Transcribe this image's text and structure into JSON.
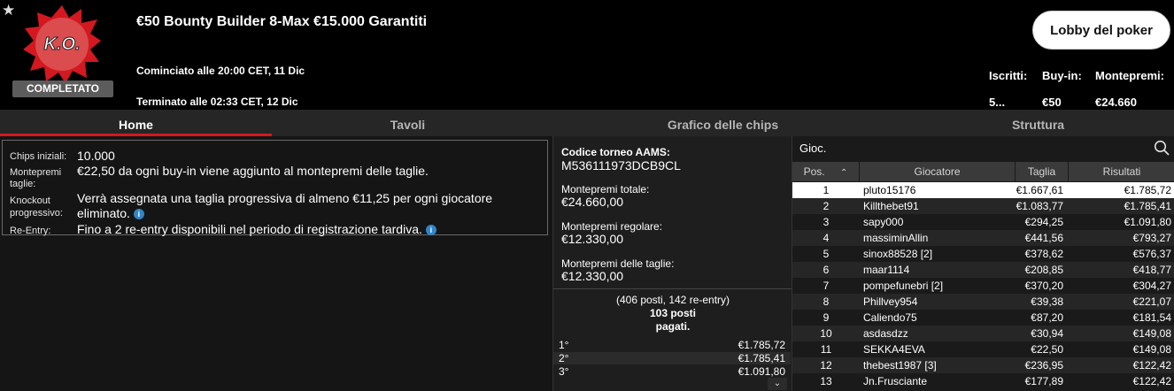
{
  "header": {
    "star_icon": "star-icon",
    "badge_text": "K.O.",
    "status": "COMPLETATO",
    "title": "€50 Bounty Builder 8-Max €15.000 Garantiti",
    "started": "Cominciato alle 20:00 CET, 11 Dic",
    "ended": "Terminato alle 02:33 CET, 12 Dic",
    "lobby_button": "Lobby del poker",
    "stats": {
      "entrants_label": "Iscritti:",
      "entrants_value": "5...",
      "buyin_label": "Buy-in:",
      "buyin_value": "€50",
      "prize_label": "Montepremi:",
      "prize_value": "€24.660"
    }
  },
  "tabs": [
    "Home",
    "Tavoli",
    "Grafico delle chips",
    "Struttura"
  ],
  "info": {
    "chips_label": "Chips iniziali:",
    "chips_value": "10.000",
    "bounty_label_1": "Montepremi",
    "bounty_label_2": "taglie:",
    "bounty_value": "€22,50 da ogni buy-in viene aggiunto al montepremi delle taglie.",
    "ko_label_1": "Knockout",
    "ko_label_2": "progressivo:",
    "ko_value_1": "Verrà assegnata una taglia progressiva di almeno €11,25 per ogni giocatore",
    "ko_value_2": "eliminato.",
    "reentry_label": "Re-Entry:",
    "reentry_value": "Fino a 2 re-entry disponibili nel periodo di registrazione tardiva."
  },
  "prize": {
    "aams_label": "Codice torneo AAMS:",
    "aams_value": "M536111973DCB9CL",
    "total_label": "Montepremi totale:",
    "total_value": "€24.660,00",
    "regular_label": "Montepremi regolare:",
    "regular_value": "€12.330,00",
    "bounty_label": "Montepremi delle taglie:",
    "bounty_value": "€12.330,00",
    "summary_1": "(406 posti, 142 re-entry)",
    "summary_2": "103 posti",
    "summary_3": "pagati.",
    "payouts": [
      {
        "place": "1°",
        "amount": "€1.785,72"
      },
      {
        "place": "2°",
        "amount": "€1.785,41"
      },
      {
        "place": "3°",
        "amount": "€1.091,80"
      }
    ]
  },
  "players": {
    "search_label": "Gioc.",
    "columns": [
      "Pos.",
      "Giocatore",
      "Taglia",
      "Risultati"
    ],
    "rows": [
      {
        "pos": "1",
        "name": "pluto15176",
        "bounty": "€1.667,61",
        "result": "€1.785,72"
      },
      {
        "pos": "2",
        "name": "Killthebet91",
        "bounty": "€1.083,77",
        "result": "€1.785,41"
      },
      {
        "pos": "3",
        "name": "sapy000",
        "bounty": "€294,25",
        "result": "€1.091,80"
      },
      {
        "pos": "4",
        "name": "massiminAllin",
        "bounty": "€441,56",
        "result": "€793,27"
      },
      {
        "pos": "5",
        "name": "sinox88528 [2]",
        "bounty": "€378,62",
        "result": "€576,37"
      },
      {
        "pos": "6",
        "name": "maar1114",
        "bounty": "€208,85",
        "result": "€418,77"
      },
      {
        "pos": "7",
        "name": "pompefunebri [2]",
        "bounty": "€370,20",
        "result": "€304,27"
      },
      {
        "pos": "8",
        "name": "Phillvey954",
        "bounty": "€39,38",
        "result": "€221,07"
      },
      {
        "pos": "9",
        "name": "Caliendo75",
        "bounty": "€87,20",
        "result": "€181,54"
      },
      {
        "pos": "10",
        "name": "asdasdzz",
        "bounty": "€30,94",
        "result": "€149,08"
      },
      {
        "pos": "11",
        "name": "SEKKA4EVA",
        "bounty": "€22,50",
        "result": "€149,08"
      },
      {
        "pos": "12",
        "name": "thebest1987 [3]",
        "bounty": "€236,95",
        "result": "€122,42"
      },
      {
        "pos": "13",
        "name": "Jn.Frusciante",
        "bounty": "€177,89",
        "result": "€122,42"
      }
    ]
  },
  "colors": {
    "accent_red": "#d31820",
    "info_blue": "#2f86c8"
  }
}
